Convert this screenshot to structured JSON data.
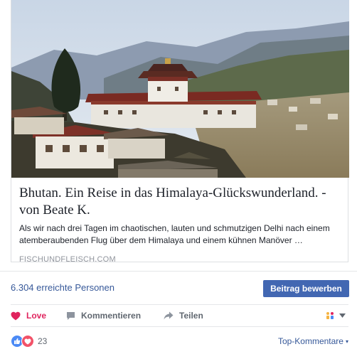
{
  "preview": {
    "title": "Bhutan. Ein Reise in das Himalaya-Glückswunderland. - von Beate K.",
    "description": "Als wir nach drei Tagen im chaotischen, lauten und schmutzigen Delhi nach einem atemberaubenden Flug über dem Himalaya und einem kühnen Manöver …",
    "domain": "FISCHUNDFLEISCH.COM"
  },
  "reach": {
    "text": "6.304 erreichte Personen",
    "button_label": "Beitrag bewerben"
  },
  "actions": {
    "love": "Love",
    "comment": "Kommentieren",
    "share": "Teilen"
  },
  "reactions": {
    "count": "23",
    "sort_label": "Top-Kommentare"
  },
  "colors": {
    "link": "#365899",
    "button": "#4267b2",
    "love": "#e0245e",
    "like_icon": "#4b8af5",
    "love_icon": "#f25268"
  }
}
